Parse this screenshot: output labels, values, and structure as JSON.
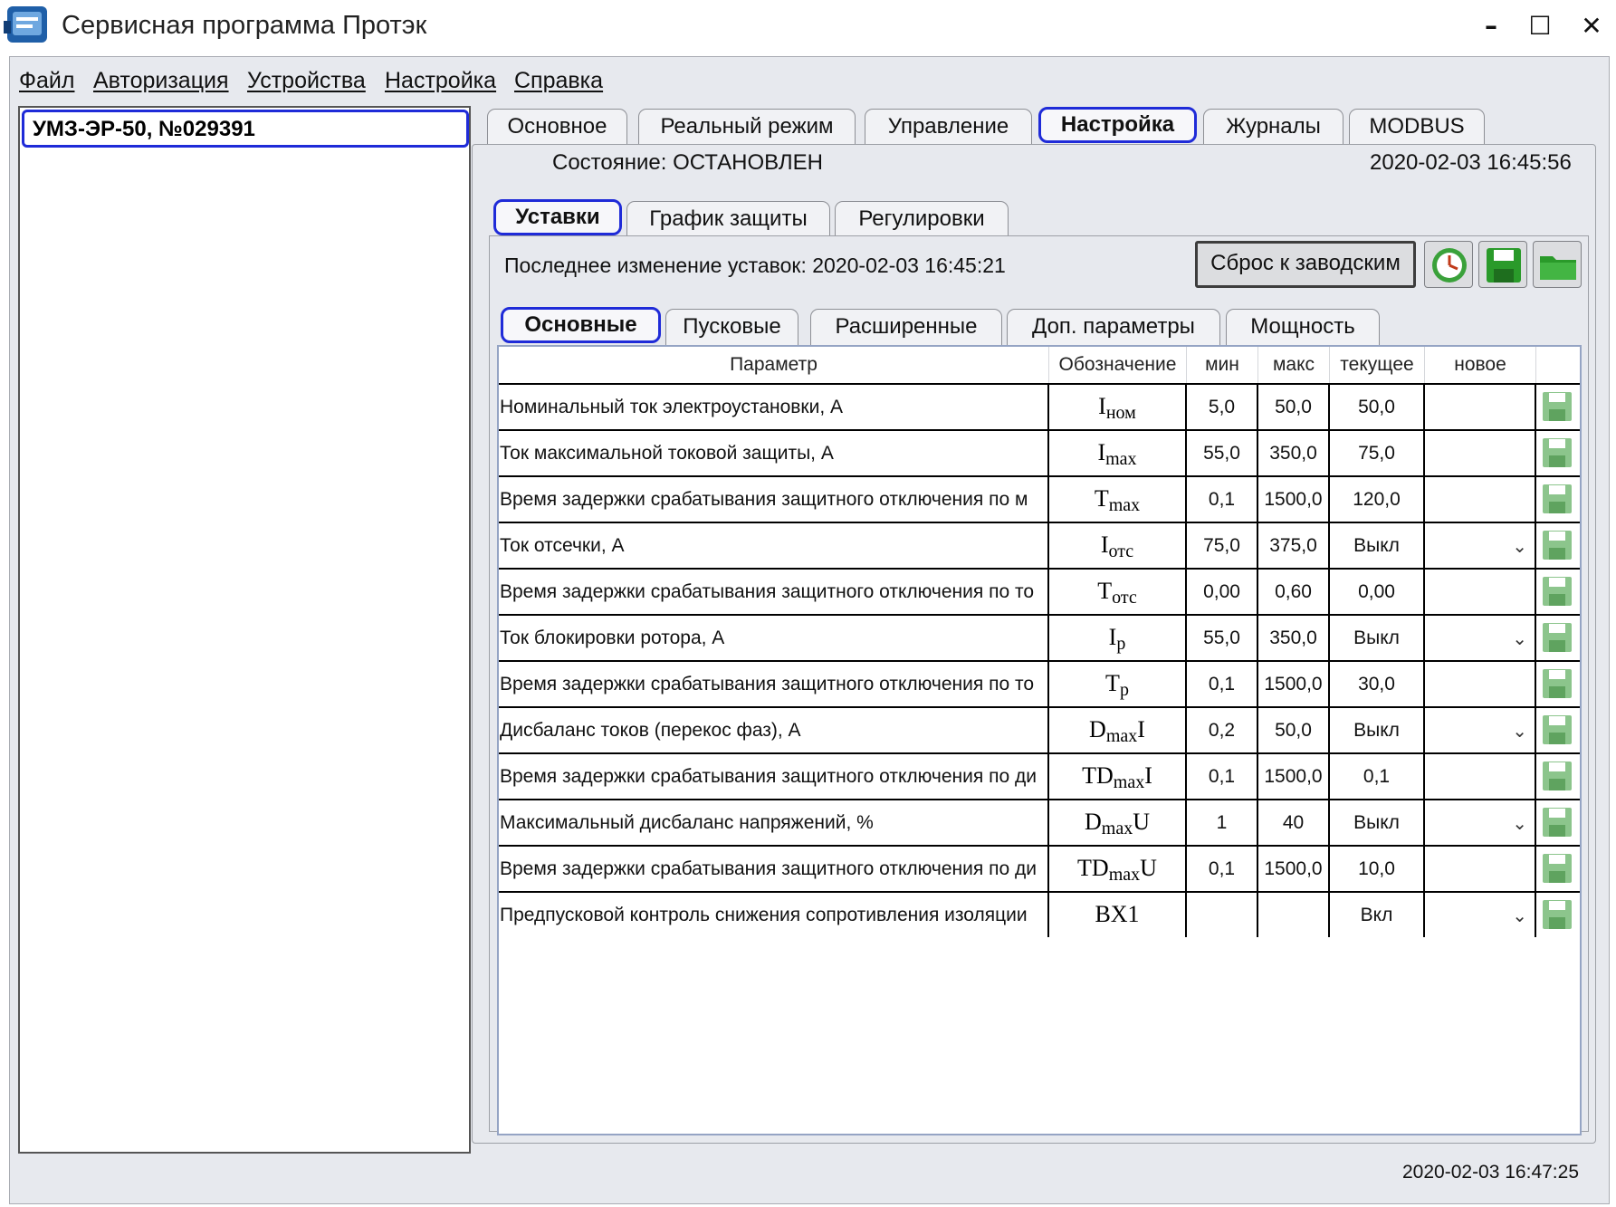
{
  "window": {
    "title": "Сервисная программа Протэк"
  },
  "menu": [
    "Файл",
    "Авторизация",
    "Устройства",
    "Настройка",
    "Справка"
  ],
  "devices": [
    "УМЗ-ЭР-50, №029391"
  ],
  "main_tabs": [
    "Основное",
    "Реальный режим",
    "Управление",
    "Настройка",
    "Журналы",
    "MODBUS"
  ],
  "active_main_tab": "Настройка",
  "status": {
    "label": "Состояние: ОСТАНОВЛЕН",
    "datetime": "2020-02-03   16:45:56"
  },
  "sub_tabs": [
    "Уставки",
    "График защиты",
    "Регулировки"
  ],
  "active_sub_tab": "Уставки",
  "last_change": "Последнее изменение уставок: 2020-02-03 16:45:21",
  "reset_button": "Сброс к заводским",
  "icons": [
    "clock-icon",
    "save-icon",
    "folder-icon"
  ],
  "group_tabs": [
    "Основные",
    "Пусковые",
    "Расширенные",
    "Доп. параметры",
    "Мощность"
  ],
  "active_group_tab": "Основные",
  "table": {
    "headers": [
      "Параметр",
      "Обозначение",
      "мин",
      "макс",
      "текущее",
      "новое"
    ],
    "rows": [
      {
        "name": "Номинальный ток электроустановки, А",
        "sym": "I",
        "sub": "ном",
        "tail": "",
        "min": "5,0",
        "max": "50,0",
        "cur": "50,0",
        "dropdown": false
      },
      {
        "name": "Ток максимальной токовой защиты, А",
        "sym": "I",
        "sub": "max",
        "tail": "",
        "min": "55,0",
        "max": "350,0",
        "cur": "75,0",
        "dropdown": false
      },
      {
        "name": "Время задержки срабатывания защитного отключения по м",
        "sym": "T",
        "sub": "max",
        "tail": "",
        "min": "0,1",
        "max": "1500,0",
        "cur": "120,0",
        "dropdown": false
      },
      {
        "name": "Ток отсечки, А",
        "sym": "I",
        "sub": "отс",
        "tail": "",
        "min": "75,0",
        "max": "375,0",
        "cur": "Выкл",
        "dropdown": true
      },
      {
        "name": "Время задержки срабатывания защитного отключения по то",
        "sym": "T",
        "sub": "отс",
        "tail": "",
        "min": "0,00",
        "max": "0,60",
        "cur": "0,00",
        "dropdown": false
      },
      {
        "name": "Ток блокировки ротора, А",
        "sym": "I",
        "sub": "р",
        "tail": "",
        "min": "55,0",
        "max": "350,0",
        "cur": "Выкл",
        "dropdown": true
      },
      {
        "name": "Время задержки срабатывания защитного отключения по то",
        "sym": "T",
        "sub": "р",
        "tail": "",
        "min": "0,1",
        "max": "1500,0",
        "cur": "30,0",
        "dropdown": false
      },
      {
        "name": "Дисбаланс токов (перекос фаз), А",
        "sym": "D",
        "sub": "max",
        "tail": "I",
        "min": "0,2",
        "max": "50,0",
        "cur": "Выкл",
        "dropdown": true
      },
      {
        "name": "Время задержки срабатывания защитного отключения по ди",
        "sym": "TD",
        "sub": "max",
        "tail": "I",
        "min": "0,1",
        "max": "1500,0",
        "cur": "0,1",
        "dropdown": false
      },
      {
        "name": "Максимальный дисбаланс напряжений, %",
        "sym": "D",
        "sub": "max",
        "tail": "U",
        "min": "1",
        "max": "40",
        "cur": "Выкл",
        "dropdown": true
      },
      {
        "name": "Время задержки срабатывания защитного отключения по ди",
        "sym": "TD",
        "sub": "max",
        "tail": "U",
        "min": "0,1",
        "max": "1500,0",
        "cur": "10,0",
        "dropdown": false
      },
      {
        "name": "Предпусковой контроль снижения сопротивления изоляции",
        "sym": "BX1",
        "sub": "",
        "tail": "",
        "min": "",
        "max": "",
        "cur": "Вкл",
        "dropdown": true
      }
    ]
  },
  "footer_time": "2020-02-03 16:47:25",
  "colors": {
    "accent": "#1f2bd8",
    "save_green": "#2a9a2a",
    "save_row_green": "#8cc58c"
  }
}
